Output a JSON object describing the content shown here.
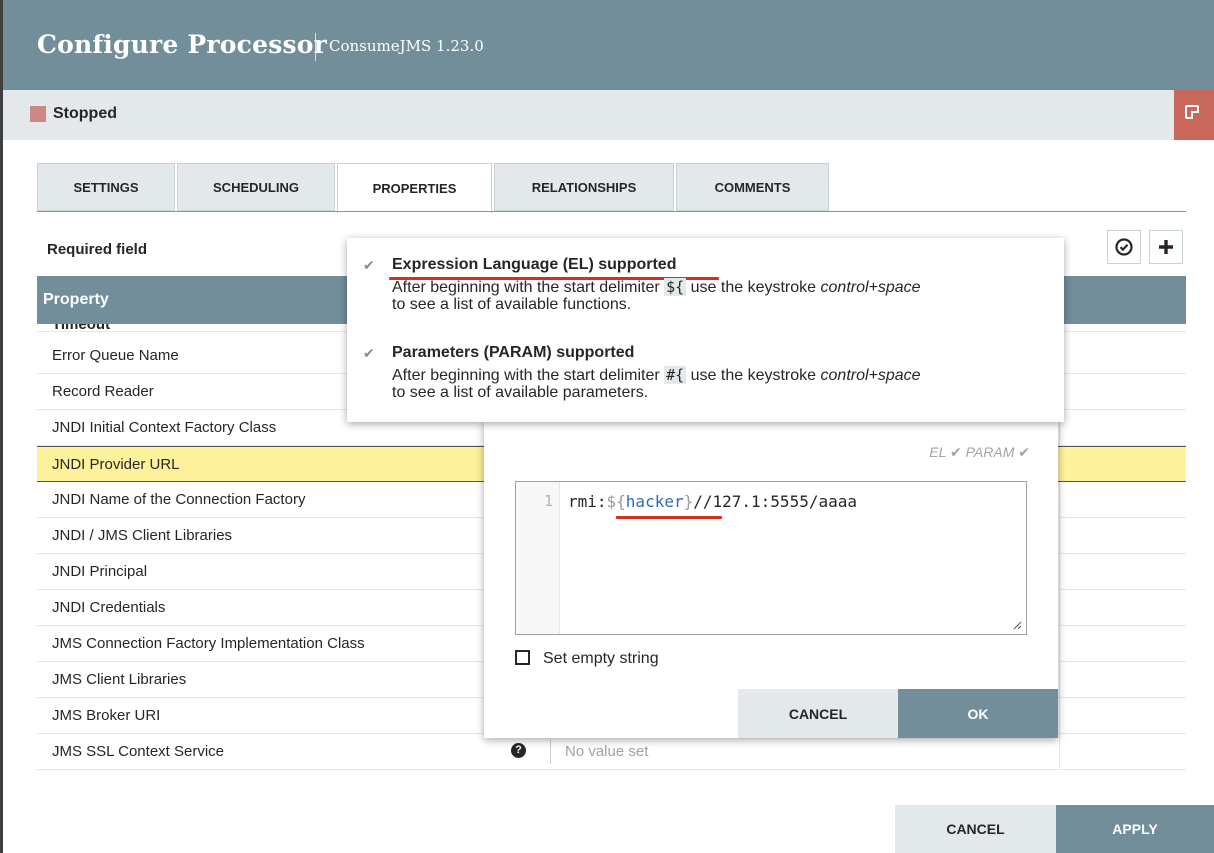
{
  "dialog": {
    "title": "Configure Processor",
    "subtitle": "ConsumeJMS 1.23.0",
    "status": "Stopped"
  },
  "tabs": [
    "SETTINGS",
    "SCHEDULING",
    "PROPERTIES",
    "RELATIONSHIPS",
    "COMMENTS"
  ],
  "active_tab": "PROPERTIES",
  "required_field": "Required field",
  "table": {
    "header": "Property",
    "partial_row": "Timeout",
    "rows": [
      "Error Queue Name",
      "Record Reader",
      "JNDI Initial Context Factory Class",
      "JNDI Provider URL",
      "JNDI Name of the Connection Factory",
      "JNDI / JMS Client Libraries",
      "JNDI Principal",
      "JNDI Credentials",
      "JMS Connection Factory Implementation Class",
      "JMS Client Libraries",
      "JMS Broker URI",
      "JMS SSL Context Service"
    ],
    "selected_row": "JNDI Provider URL",
    "last_row_value": "No value set"
  },
  "tooltip": {
    "el_title": "Expression Language (EL) supported",
    "el_desc_1": "After beginning with the start delimiter",
    "el_delim": "${",
    "el_desc_2": "use the keystroke",
    "el_key": "control+space",
    "el_desc_3": "to see a list of available functions.",
    "param_title": "Parameters (PARAM) supported",
    "param_desc_1": "After beginning with the start delimiter",
    "param_delim": "#{",
    "param_desc_2": "use the keystroke",
    "param_key": "control+space",
    "param_desc_3": "to see a list of available parameters."
  },
  "editor": {
    "flags": "EL ✔   PARAM ✔",
    "line_number": "1",
    "code_prefix": "rmi:",
    "code_el_open": "${",
    "code_var": "hacker",
    "code_el_close": "}",
    "code_suffix": "//127.1:5555/aaaa",
    "empty_string_label": "Set empty string",
    "cancel": "CANCEL",
    "ok": "OK"
  },
  "footer": {
    "cancel": "CANCEL",
    "apply": "APPLY"
  },
  "colors": {
    "header": "#728e9b",
    "status_stopped": "#d18686",
    "highlight_row": "#fdf19c",
    "annotation_red": "#d32f1f"
  }
}
